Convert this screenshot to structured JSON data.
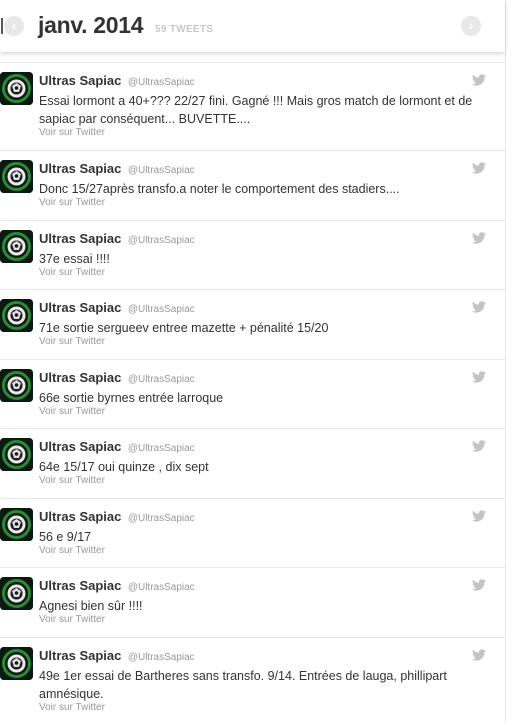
{
  "header": {
    "prev_glyph": "‹",
    "month": "janv. 2014",
    "tweet_count": "59 TWEETS",
    "next_glyph": "›"
  },
  "colors": {
    "accent_avatar": "#2a8a3a",
    "muted": "#999999"
  },
  "icons": {
    "tweet_source": "twitter-bird-icon",
    "nav": "chevron-icon"
  },
  "tweets": [
    {
      "name": "Ultras Sapiac",
      "handle": "@UltrasSapiac",
      "text": "Essai lormont a 40+??? 22/27 fini. Gagné !!! Mais gros match de lormont et de sapiac par conséquent... BUVETTE....",
      "action": "Voir sur Twitter"
    },
    {
      "name": "Ultras Sapiac",
      "handle": "@UltrasSapiac",
      "text": "Donc 15/27après transfo.a noter le comportement des stadiers....",
      "action": "Voir sur Twitter"
    },
    {
      "name": "Ultras Sapiac",
      "handle": "@UltrasSapiac",
      "text": "37e essai !!!!",
      "action": "Voir sur Twitter"
    },
    {
      "name": "Ultras Sapiac",
      "handle": "@UltrasSapiac",
      "text": "71e sortie sergueev entree mazette + pénalité 15/20",
      "action": "Voir sur Twitter"
    },
    {
      "name": "Ultras Sapiac",
      "handle": "@UltrasSapiac",
      "text": "66e sortie byrnes entrée larroque",
      "action": "Voir sur Twitter"
    },
    {
      "name": "Ultras Sapiac",
      "handle": "@UltrasSapiac",
      "text": "64e 15/17 oui quinze , dix sept",
      "action": "Voir sur Twitter"
    },
    {
      "name": "Ultras Sapiac",
      "handle": "@UltrasSapiac",
      "text": "56 e 9/17",
      "action": "Voir sur Twitter"
    },
    {
      "name": "Ultras Sapiac",
      "handle": "@UltrasSapiac",
      "text": "Agnesi bien sûr !!!!",
      "action": "Voir sur Twitter"
    },
    {
      "name": "Ultras Sapiac",
      "handle": "@UltrasSapiac",
      "text": "49e 1er essai de Bartheres sans transfo. 9/14. Entrées de lauga, phillipart amnésique.",
      "action": "Voir sur Twitter"
    }
  ]
}
